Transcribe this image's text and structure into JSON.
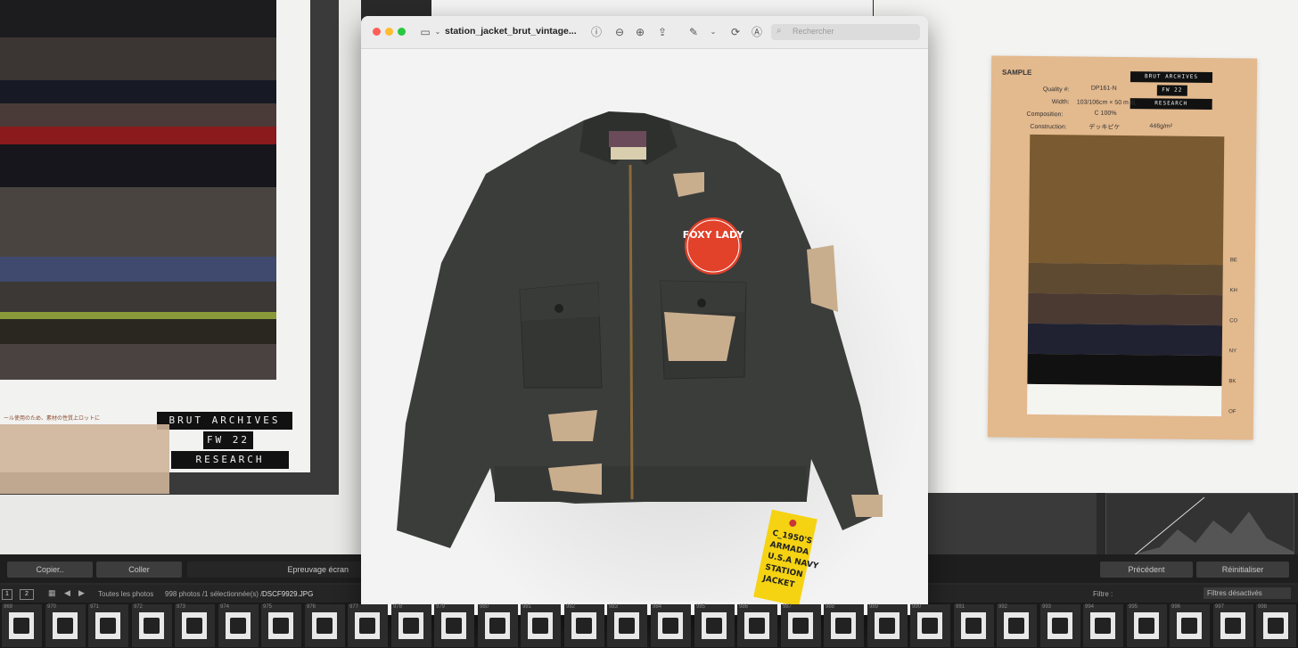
{
  "window": {
    "title": "station_jacket_brut_vintage...",
    "search_placeholder": "Rechercher"
  },
  "toolbar": {
    "icons": [
      "sidebar-icon",
      "info-icon",
      "zoom-out-icon",
      "zoom-in-icon",
      "share-icon",
      "markup-pen-icon",
      "rotate-icon",
      "annotate-icon"
    ]
  },
  "fabric_card_left": {
    "labels": [
      "BRUT ARCHIVES",
      "FW 22",
      "RESEARCH"
    ],
    "japanese_note": "ール使用のため、素材の性質上ロットに"
  },
  "swatch_card_right": {
    "heading": "SAMPLE",
    "labels": [
      "BRUT ARCHIVES",
      "FW 22",
      "RESEARCH"
    ],
    "quality_label": "Quality #:",
    "quality_value": "DP161-N",
    "width_label": "Width:",
    "width_value": "103/106cm × 50 m 乱",
    "composition_label": "Composition:",
    "composition_value": "C 100%",
    "construction_label": "Construction:",
    "construction_value": "デッキピケ",
    "weight_value": "446g/m²",
    "color_codes": [
      "BE",
      "KH",
      "CO",
      "NY",
      "BK",
      "OF"
    ]
  },
  "photo": {
    "emblem_text": "FOXY LADY",
    "tag_lines": [
      "C_1950'S",
      "ARMADA",
      "U.S.A NAVY",
      "STATION",
      "JACKET"
    ]
  },
  "lightroom": {
    "copy_button": "Copier..",
    "paste_button": "Coller",
    "soft_proof_label": "Epreuvage écran",
    "previous_button": "Précédent",
    "reset_button": "Réinitialiser",
    "page_1": "1",
    "page_2": "2",
    "source": "Toutes les photos",
    "count": "998 photos /1 sélectionnée(s) /",
    "filename": "DSCF9929.JPG",
    "filter_label": "Filtre :",
    "filter_value": "Filtres désactivés",
    "film_numbers": [
      "969",
      "970",
      "971",
      "972",
      "973",
      "974",
      "975",
      "976",
      "977",
      "978",
      "979",
      "980",
      "981",
      "982",
      "983",
      "984",
      "985",
      "986",
      "987",
      "988",
      "989",
      "990",
      "991",
      "992",
      "993",
      "994",
      "995",
      "996",
      "997",
      "998"
    ]
  },
  "colors": {
    "close": "#ff5f57",
    "minimize": "#febc2e",
    "zoom": "#28c840",
    "jacket": "#3b3d3b",
    "emblem": "#e2412a",
    "tag": "#f5d312"
  }
}
